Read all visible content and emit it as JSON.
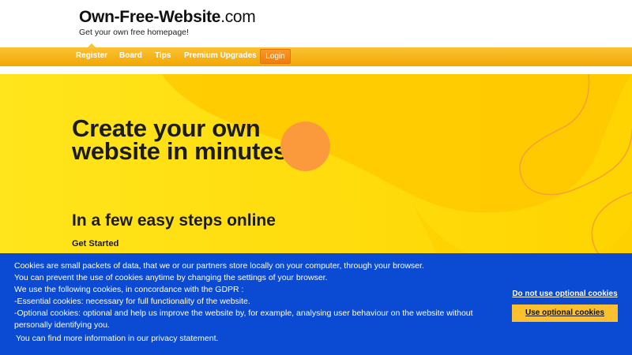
{
  "brand": {
    "name_bold": "Own-Free-Website",
    "name_tld": ".com",
    "tagline": "Get your own free homepage!"
  },
  "nav": {
    "items": [
      {
        "label": "Register",
        "active": true
      },
      {
        "label": "Board"
      },
      {
        "label": "Tips"
      },
      {
        "label": "Premium Upgrades"
      }
    ],
    "login_label": "Login"
  },
  "hero": {
    "title": "Create your own website in minutes",
    "subtitle": "In a few easy steps online",
    "cta_label": "Get Started"
  },
  "cookie_banner": {
    "lines": [
      "Cookies are small packets of data, that we or our partners store locally on your computer, through your browser.",
      "You can prevent the use of cookies anytime by changing the settings of your browser.",
      "We use the following cookies, in concordance with the GDPR :",
      "-Essential cookies: necessary for full functionality of the website.",
      "-Optional cookies: optional and help us improve the website by, for example, analysing user behaviour on the website without personally identifying you."
    ],
    "privacy_line": "You can find more information in our privacy statement.",
    "decline_label": "Do not use optional cookies",
    "accept_label": "Use optional cookies"
  },
  "colors": {
    "nav_gradient_top": "#fbc233",
    "nav_gradient_bottom": "#f2a704",
    "login_button": "#ee7d12",
    "hero_background": "#ffe21b",
    "hero_accent_circle": "#fb9a3c",
    "cookie_background": "#0b4bd4",
    "cookie_accept_button": "#fcc02e"
  }
}
